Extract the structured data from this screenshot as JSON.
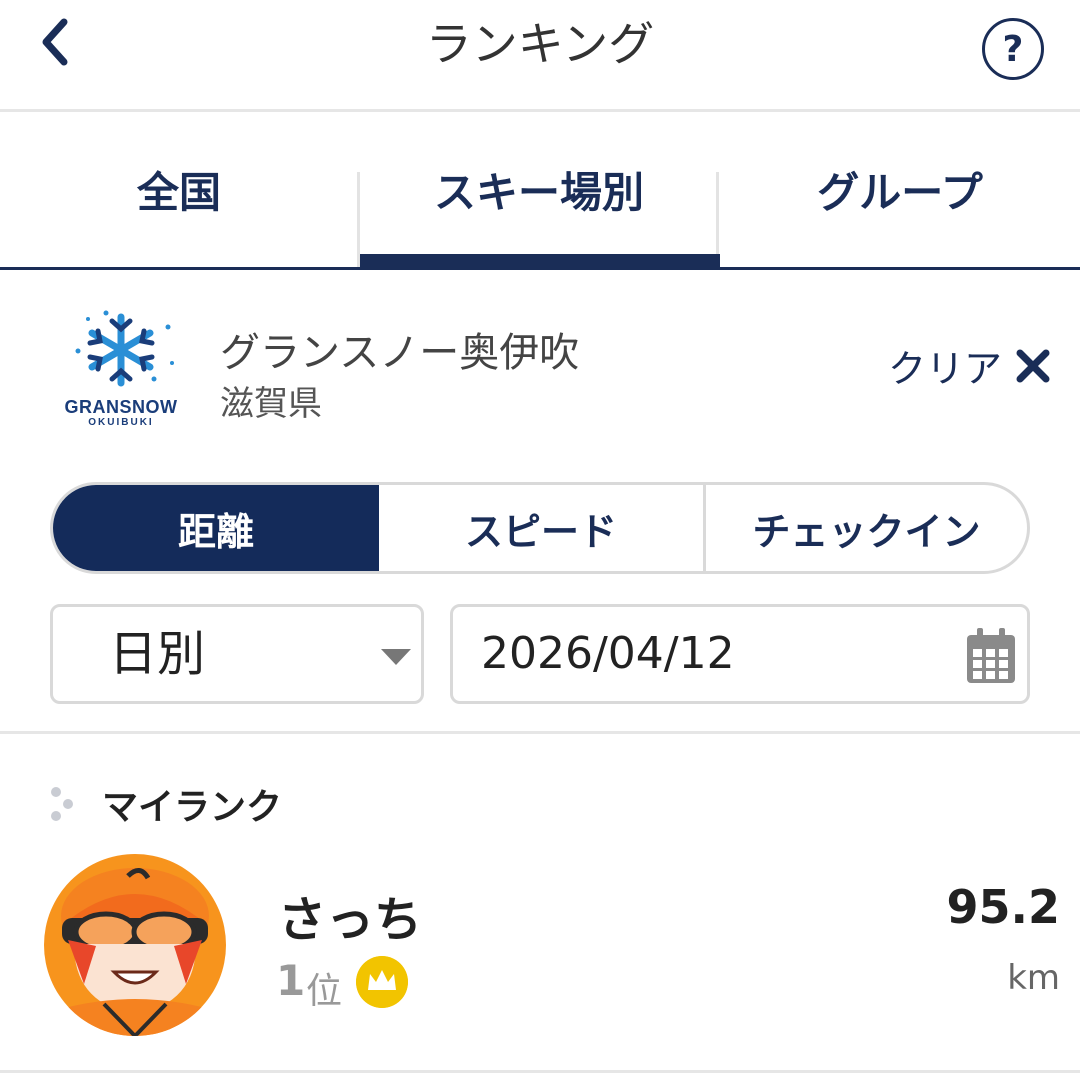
{
  "header": {
    "title": "ランキング",
    "help_label": "?"
  },
  "tabs": [
    {
      "label": "全国",
      "active": false
    },
    {
      "label": "スキー場別",
      "active": true
    },
    {
      "label": "グループ",
      "active": false
    }
  ],
  "resort": {
    "logo_text": "GRANSNOW",
    "logo_sub": "OKUIBUKI",
    "name": "グランスノー奥伊吹",
    "prefecture": "滋賀県",
    "clear_label": "クリア"
  },
  "metric_tabs": [
    {
      "label": "距離",
      "active": true
    },
    {
      "label": "スピード",
      "active": false
    },
    {
      "label": "チェックイン",
      "active": false
    }
  ],
  "period": {
    "selected": "日別"
  },
  "date": {
    "value": "2026/04/12"
  },
  "my_rank": {
    "title": "マイランク",
    "user_name": "さっち",
    "rank": "1",
    "rank_suffix": "位",
    "value": "95.2",
    "unit": "km"
  },
  "colors": {
    "navy": "#142b5a",
    "crown": "#f2c400",
    "avatar_bg": "#f7941d"
  }
}
